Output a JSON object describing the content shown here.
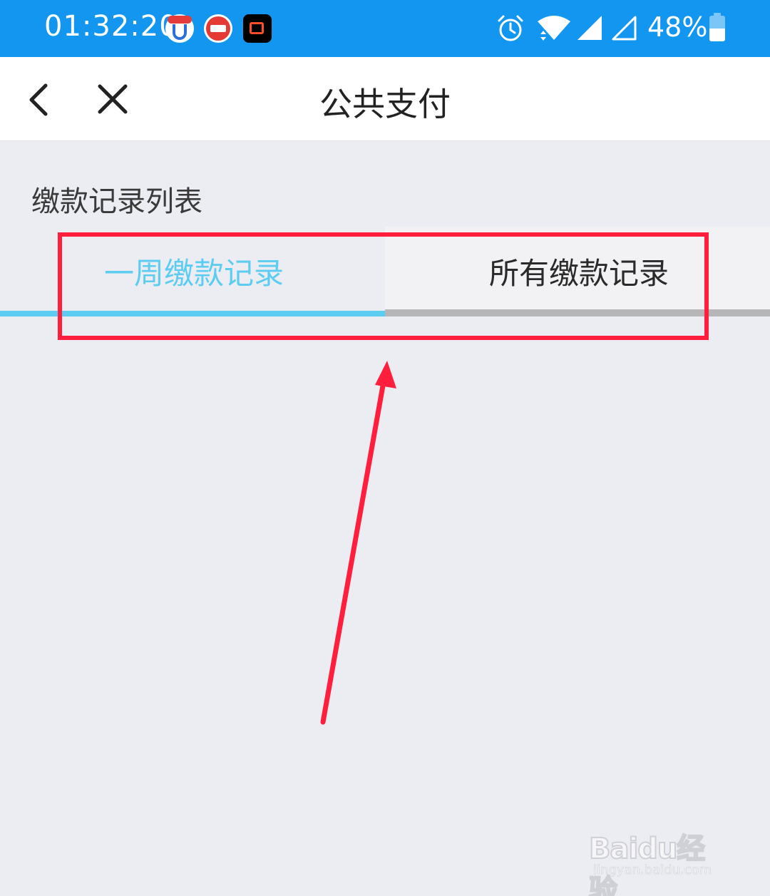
{
  "status_bar": {
    "time": "01:32:20",
    "battery": "48%",
    "notification_icons": [
      "app-icon-1",
      "toutiao-icon",
      "video-app-icon"
    ],
    "system_icons": [
      "alarm-icon",
      "wifi-icon",
      "signal-icon",
      "signal-empty-icon",
      "battery-icon"
    ],
    "background_color": "#1296f0"
  },
  "navbar": {
    "title": "公共支付",
    "back_icon": "chevron-left-icon",
    "close_icon": "close-icon"
  },
  "section": {
    "title": "缴款记录列表"
  },
  "tabs": [
    {
      "label": "一周缴款记录",
      "selected": true,
      "color": "#5ccdf0"
    },
    {
      "label": "所有缴款记录",
      "selected": false,
      "color": "#2a2a2a"
    }
  ],
  "annotation": {
    "box_color": "#ff1f3d",
    "arrow_color": "#ff1f3d"
  },
  "watermark": {
    "brand": "Baidu经验",
    "url": "jingyan.baidu.com"
  }
}
